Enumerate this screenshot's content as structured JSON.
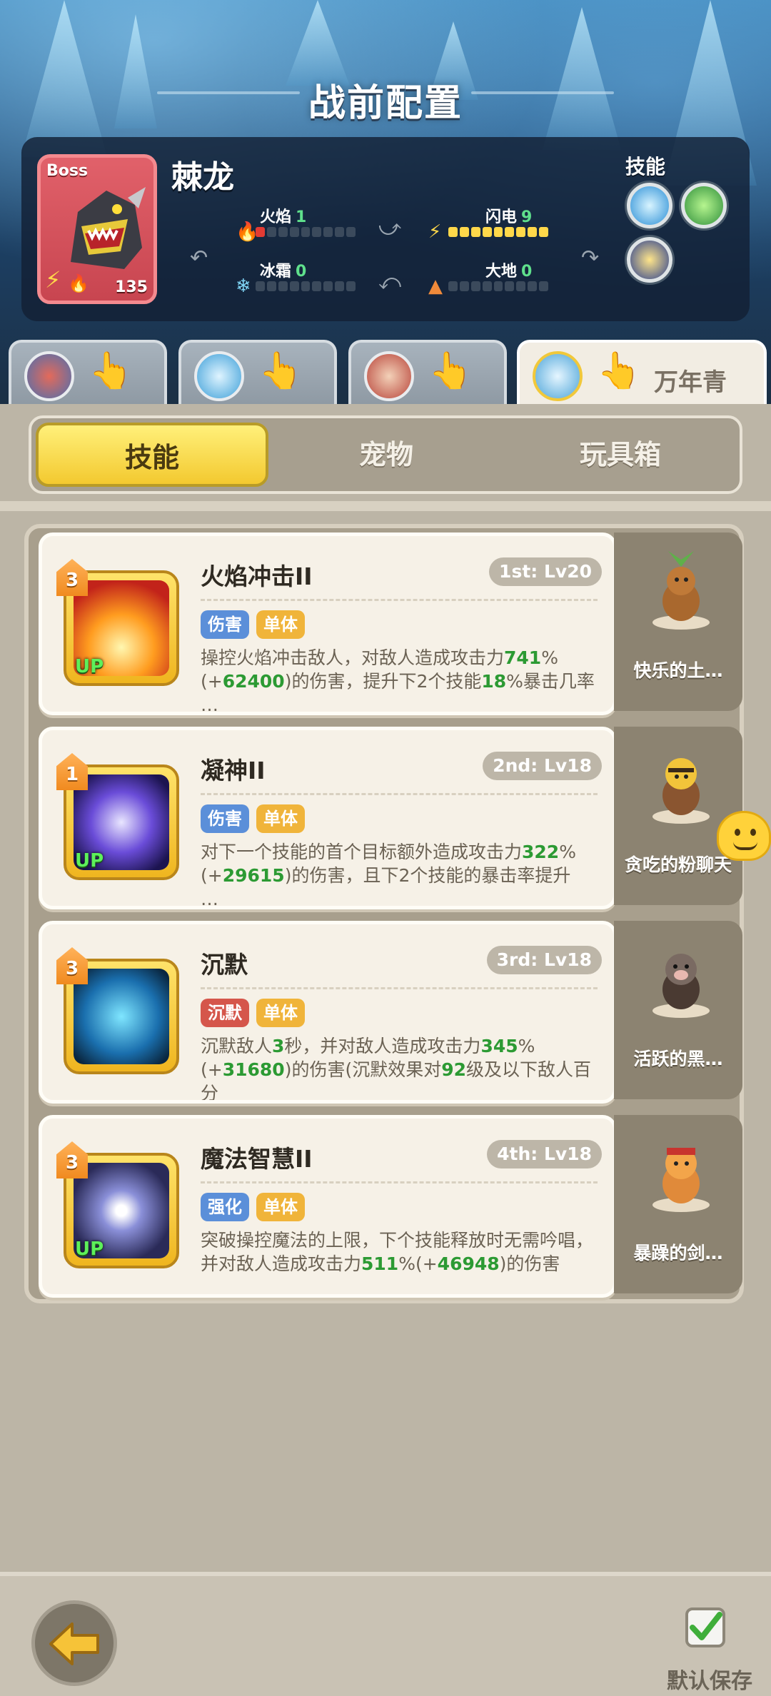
{
  "header": {
    "title": "战前配置"
  },
  "boss": {
    "tag": "Boss",
    "name": "棘龙",
    "level": "135",
    "skills_label": "技能",
    "elements": [
      {
        "name": "火焰",
        "value": "1"
      },
      {
        "name": "闪电",
        "value": "9"
      },
      {
        "name": "冰霜",
        "value": "0"
      },
      {
        "name": "大地",
        "value": "0"
      }
    ]
  },
  "hero_tabs": [
    {
      "name": ""
    },
    {
      "name": ""
    },
    {
      "name": ""
    },
    {
      "name": "万年青"
    }
  ],
  "tabs": {
    "skills": "技能",
    "pets": "宠物",
    "toybox": "玩具箱"
  },
  "skills": [
    {
      "rank": "3",
      "title": "火焰冲击II",
      "level": "1st: Lv20",
      "tags": [
        "伤害",
        "单体"
      ],
      "desc_parts": [
        "操控火焰冲击敌人，对敌人造成攻击力",
        "741",
        "%(+",
        "62400",
        ")的伤害，提升下2个技能",
        "18",
        "%暴击几率",
        "…"
      ],
      "up": "UP",
      "pet": "快乐的土…"
    },
    {
      "rank": "1",
      "title": "凝神II",
      "level": "2nd: Lv18",
      "tags": [
        "伤害",
        "单体"
      ],
      "desc_parts": [
        "对下一个技能的首个目标额外造成攻击力",
        "322",
        "%(+",
        "29615",
        ")的伤害，且下2个技能的暴击率提升",
        "…"
      ],
      "up": "UP",
      "pet": "贪吃的粉聊天"
    },
    {
      "rank": "3",
      "title": "沉默",
      "level": "3rd: Lv18",
      "tags": [
        "沉默",
        "单体"
      ],
      "desc_parts": [
        "沉默敌人",
        "3",
        "秒，并对敌人造成攻击力",
        "345",
        "%(+",
        "31680",
        ")的伤害(沉默效果对",
        "92",
        "级及以下敌人百分",
        "…"
      ],
      "up": "",
      "pet": "活跃的黑…"
    },
    {
      "rank": "3",
      "title": "魔法智慧II",
      "level": "4th: Lv18",
      "tags": [
        "强化",
        "单体"
      ],
      "desc_parts": [
        "突破操控魔法的上限，下个技能释放时无需吟唱，并对敌人造成攻击力",
        "511",
        "%(+",
        "46948",
        ")的伤害"
      ],
      "up": "UP",
      "pet": "暴躁的剑…"
    }
  ],
  "footer": {
    "save_label": "默认保存"
  },
  "colors": {
    "accent_yellow": "#f3c92f",
    "value_green": "#2c9a33",
    "tag_blue": "#5b8fd9",
    "tag_orange": "#f0b43a",
    "tag_red": "#d5564b"
  },
  "icons": {
    "back": "arrow-left-icon",
    "save": "checkmark-icon"
  }
}
